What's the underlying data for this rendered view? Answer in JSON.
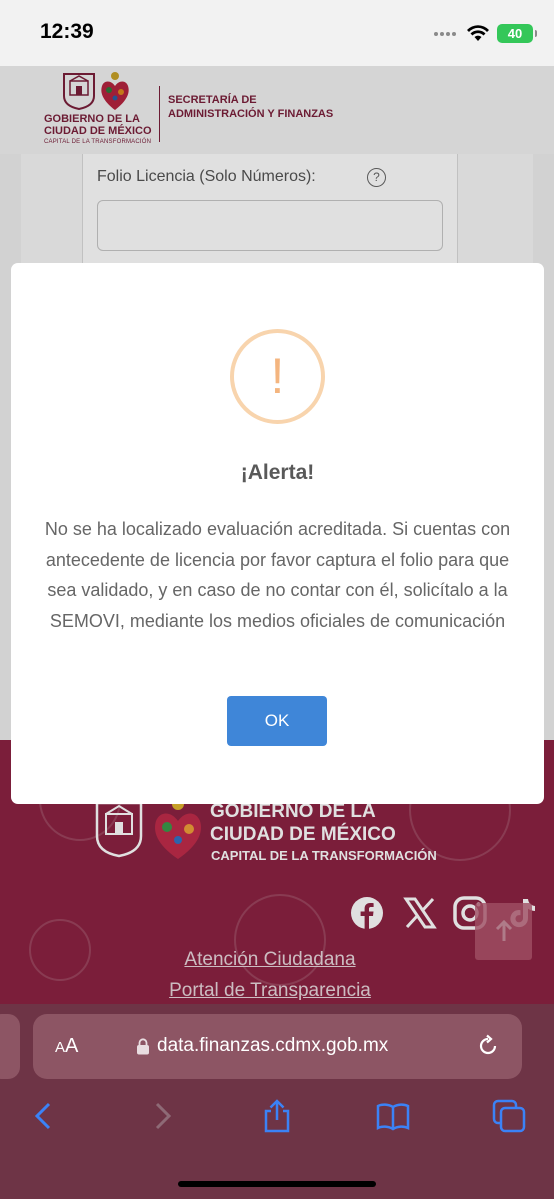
{
  "status_bar": {
    "time": "12:39",
    "battery": "40"
  },
  "header": {
    "gov_line1": "GOBIERNO DE LA",
    "gov_line2": "CIUDAD DE MÉXICO",
    "gov_tagline": "CAPITAL DE LA TRANSFORMACIÓN",
    "secretaria_line1": "SECRETARÍA DE",
    "secretaria_line2": "ADMINISTRACIÓN Y FINANZAS"
  },
  "form": {
    "folio_label": "Folio Licencia (Solo Números):",
    "help_glyph": "?",
    "folio_value": ""
  },
  "modal": {
    "icon": "!",
    "title": "¡Alerta!",
    "message": "No se ha localizado evaluación acreditada. Si cuentas con antecedente de licencia por favor captura el folio para que sea validado, y en caso de no contar con él, solicítalo a la SEMOVI, mediante los medios oficiales de comunicación",
    "ok_label": "OK"
  },
  "footer": {
    "gov_line1": "GOBIERNO DE LA",
    "gov_line2": "CIUDAD DE MÉXICO",
    "tagline": "CAPITAL DE LA TRANSFORMACIÓN",
    "links": [
      "Atención Ciudadana",
      "Portal de Transparencia"
    ],
    "social": [
      "facebook-icon",
      "x-icon",
      "instagram-icon",
      "tiktok-icon"
    ]
  },
  "browser": {
    "aa_small": "A",
    "aa_large": "A",
    "url": "data.finanzas.cdmx.gob.mx"
  },
  "colors": {
    "brand": "#8c2342",
    "ok_button": "#3f86d8",
    "warning_ring": "#f8d4ad",
    "ios_blue": "#3b82f6"
  }
}
